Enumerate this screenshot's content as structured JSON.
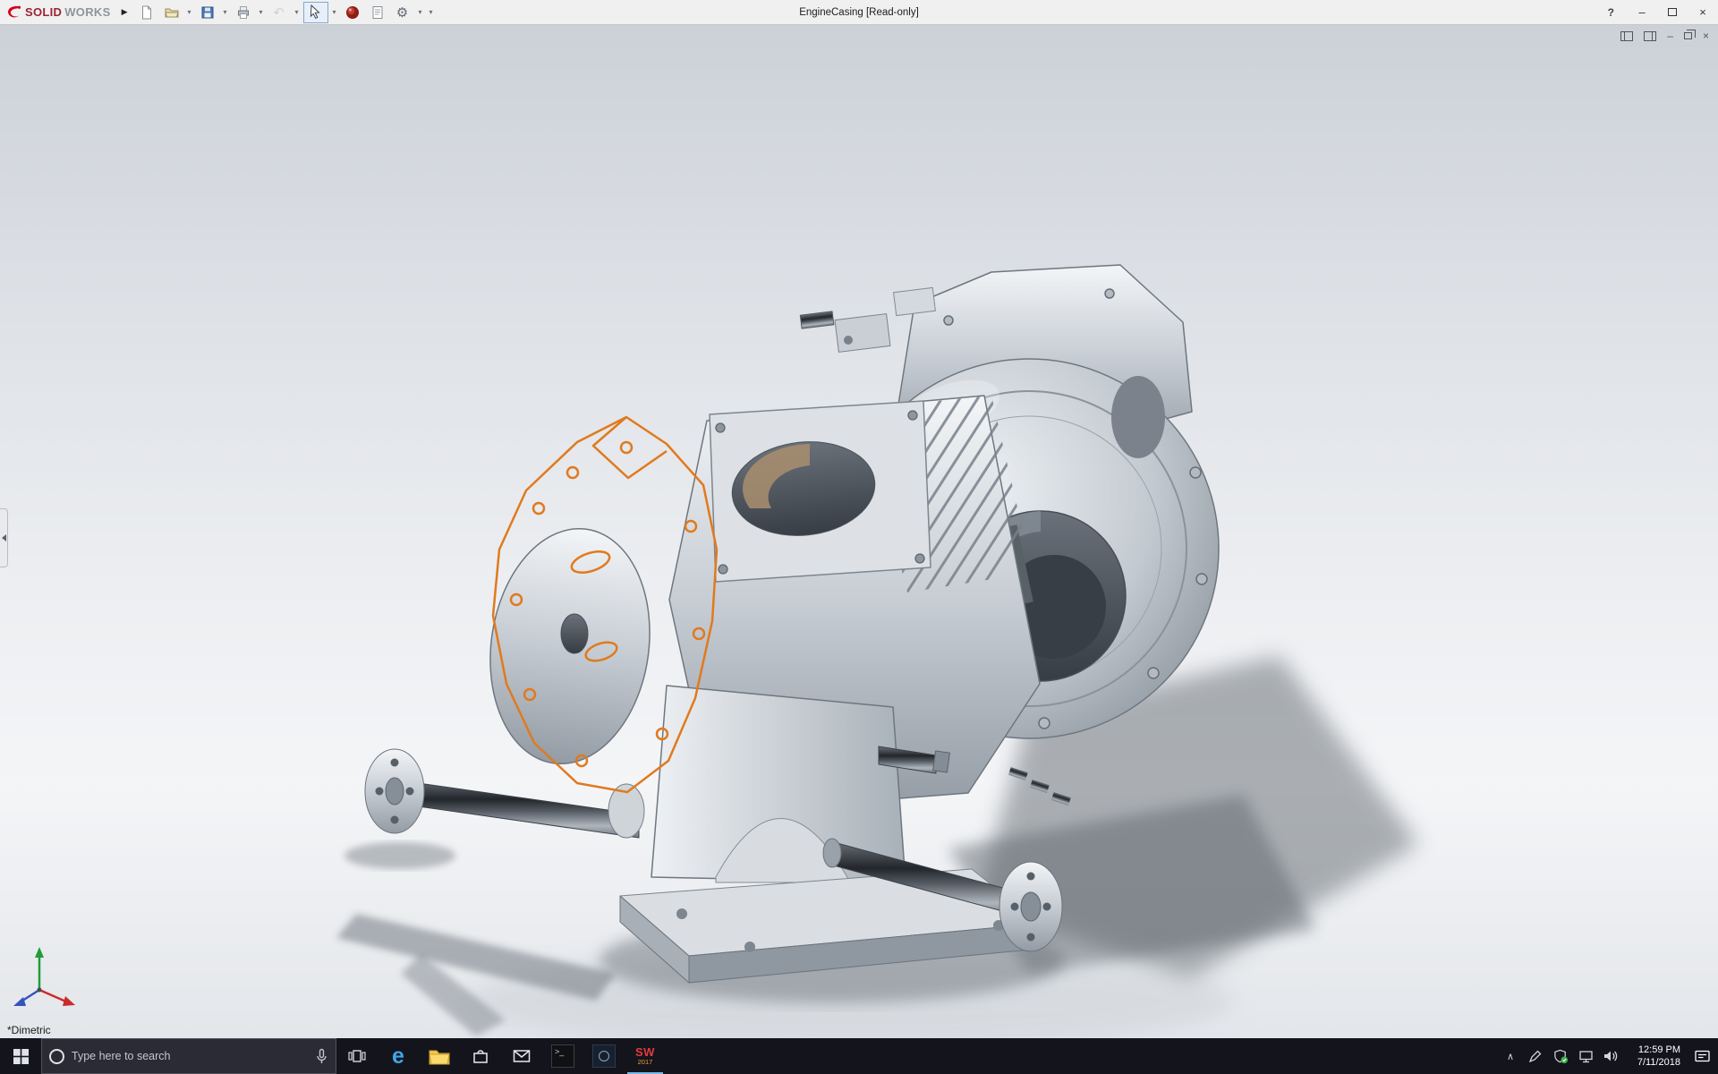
{
  "titlebar": {
    "logo_solid": "SOLID",
    "logo_works": "WORKS",
    "document_title": "EngineCasing [Read-only]"
  },
  "glyphs": {
    "flyout": "▶",
    "dropdown": "▾",
    "undo": "↶",
    "gear": "⚙",
    "help": "?",
    "minimize": "–",
    "close": "×",
    "chevron_up": "∧",
    "edge_letter": "e",
    "prompt": ">_"
  },
  "toolbar_icons": [
    "new-document",
    "open-document",
    "save",
    "print",
    "undo",
    "select-cursor",
    "red-sphere",
    "file-properties",
    "options-gear"
  ],
  "doc_window_controls": [
    "pane-left",
    "pane-right",
    "minimize",
    "restore",
    "close"
  ],
  "viewport": {
    "orientation_label": "*Dimetric",
    "model_name": "EngineCasing",
    "sketch_highlight_color": "#e07a1e"
  },
  "taskbar": {
    "search_placeholder": "Type here to search",
    "solidworks_badge_top": "SW",
    "solidworks_badge_year": "2017",
    "time": "12:59 PM",
    "date": "7/11/2018"
  }
}
